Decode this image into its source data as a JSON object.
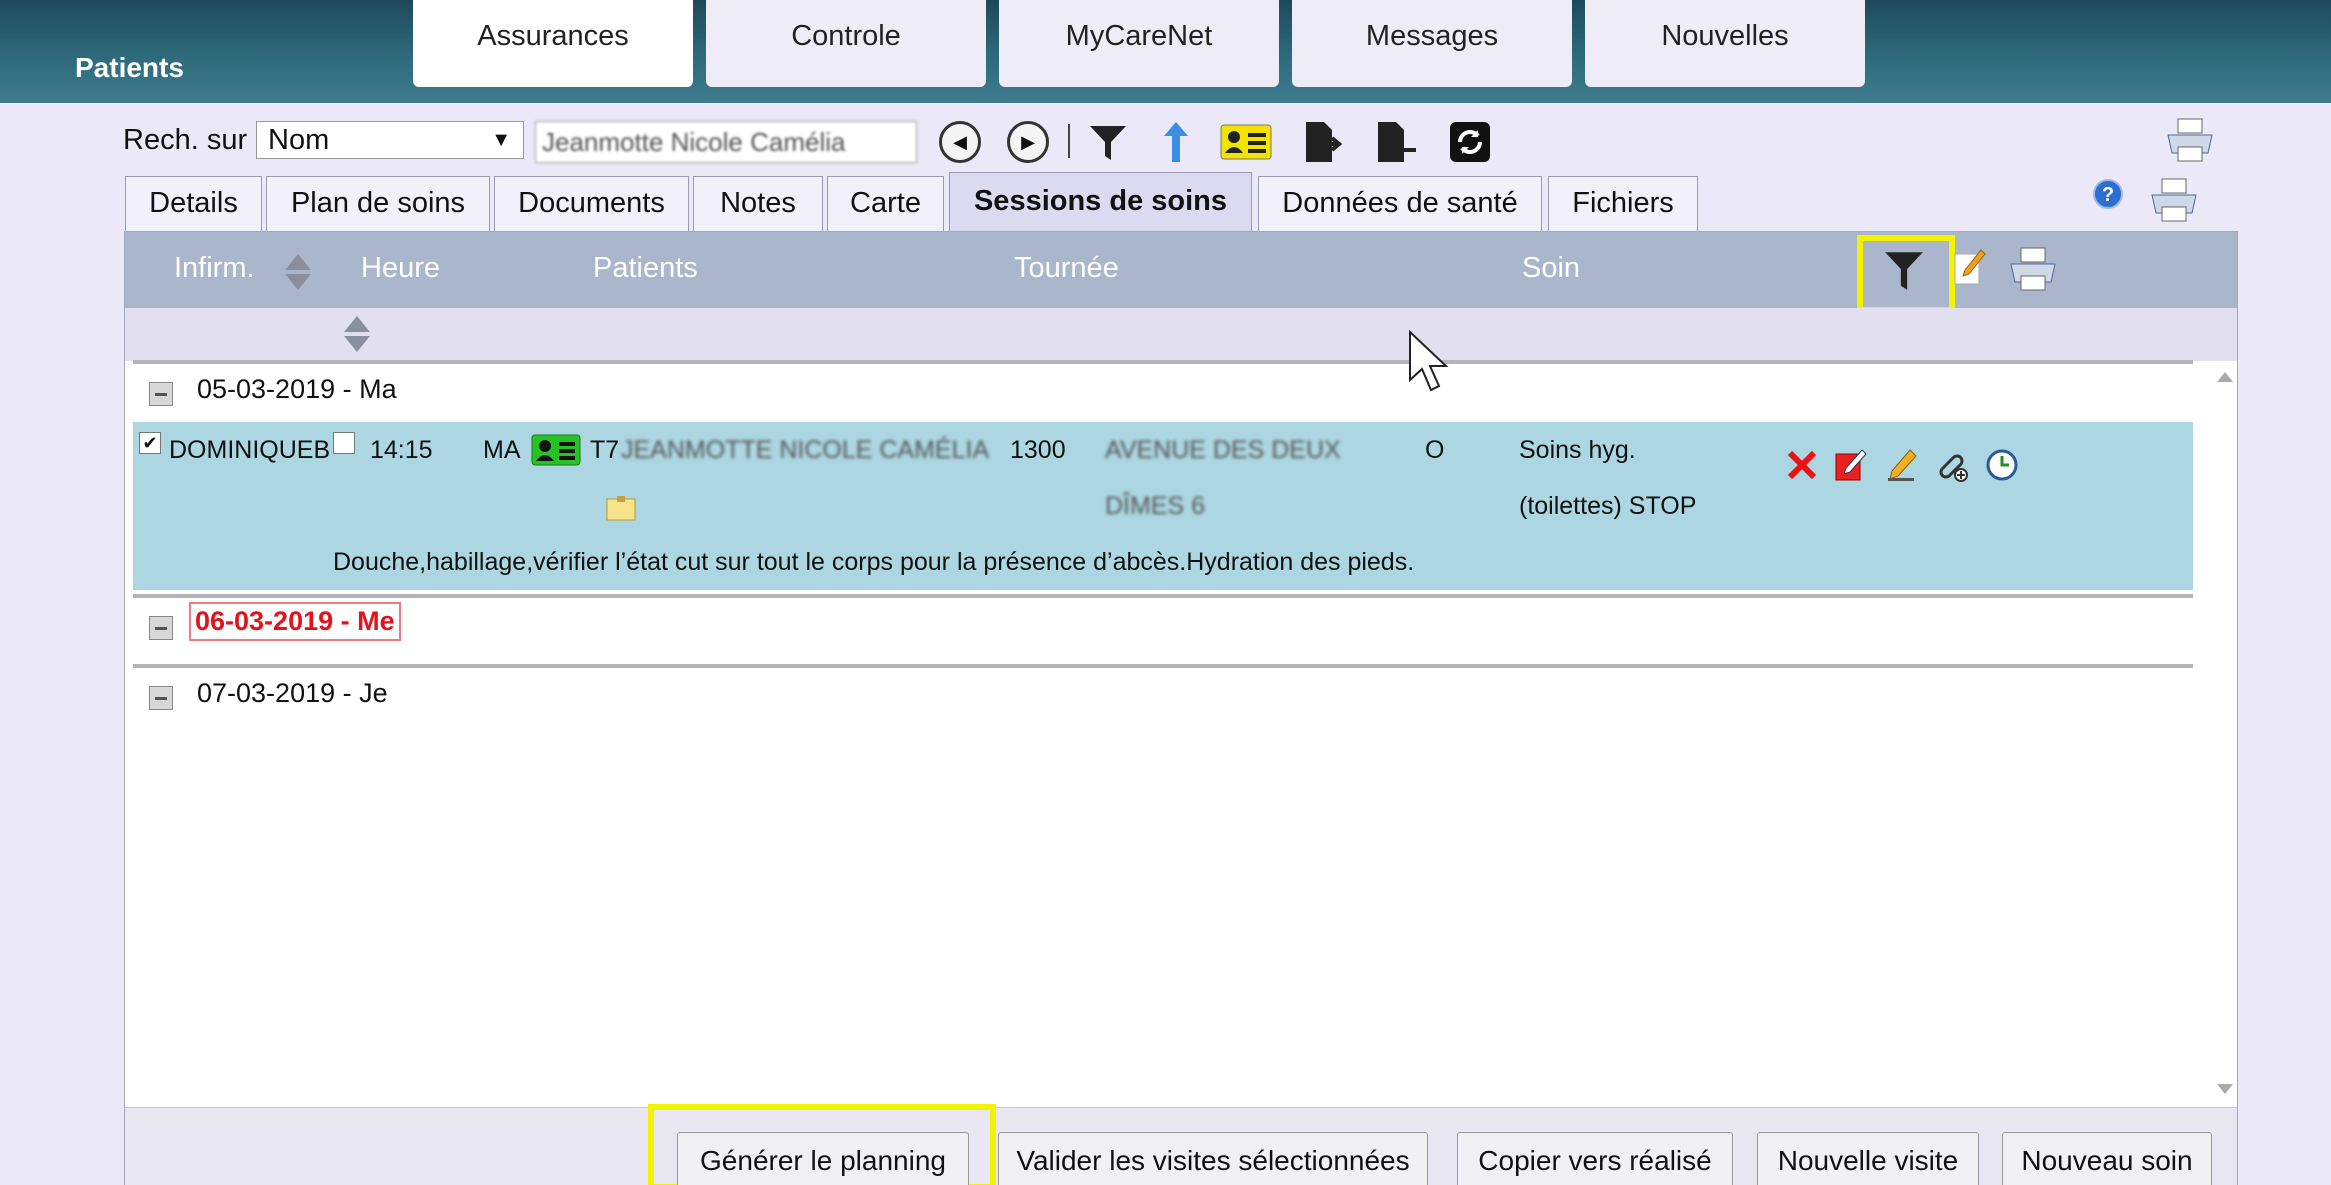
{
  "app": {
    "brand": "Patients"
  },
  "top_tabs": [
    {
      "label": "Assurances",
      "active": true
    },
    {
      "label": "Controle",
      "active": false
    },
    {
      "label": "MyCareNet",
      "active": false
    },
    {
      "label": "Messages",
      "active": false
    },
    {
      "label": "Nouvelles",
      "active": false
    }
  ],
  "search": {
    "label": "Rech. sur",
    "field": "Nom",
    "value": "Jeanmotte Nicole Camélia"
  },
  "sub_tabs": [
    {
      "label": "Details"
    },
    {
      "label": "Plan de soins"
    },
    {
      "label": "Documents"
    },
    {
      "label": "Notes"
    },
    {
      "label": "Carte"
    },
    {
      "label": "Sessions de soins",
      "active": true
    },
    {
      "label": "Données de santé"
    },
    {
      "label": "Fichiers"
    }
  ],
  "columns": {
    "nurse": "Infirm.",
    "time": "Heure",
    "patients": "Patients",
    "round": "Tournée",
    "care": "Soin"
  },
  "dates": [
    {
      "label": "05-03-2019 - Ma",
      "today": false
    },
    {
      "label": "06-03-2019 - Me",
      "today": true
    },
    {
      "label": "07-03-2019 - Je",
      "today": false
    }
  ],
  "visit": {
    "checked": true,
    "nurse": "DOMINIQUEB",
    "time": "14:15",
    "period": "MA",
    "patient": "JEANMOTTE NICOLE CAMÉLIA",
    "patient_prefix": "T7",
    "postcode": "1300",
    "address_line1": "AVENUE DES DEUX",
    "address_line2": "DÎMES 6",
    "flag": "O",
    "care_line1": "Soins hyg.",
    "care_line2": "(toilettes) STOP",
    "note": "Douche,habillage,vérifier l’état cut sur tout le corps pour la présence d’abcès.Hydration des pieds."
  },
  "footer_buttons": {
    "generate": "Générer le planning",
    "validate": "Valider les visites sélectionnées",
    "copy": "Copier vers réalisé",
    "new_visit": "Nouvelle visite",
    "new_care": "Nouveau soin"
  },
  "colors": {
    "header_bar": "#1e4a5a",
    "highlight": "#f3f300",
    "visit_row": "#acd7e2",
    "today": "#e3121c"
  }
}
